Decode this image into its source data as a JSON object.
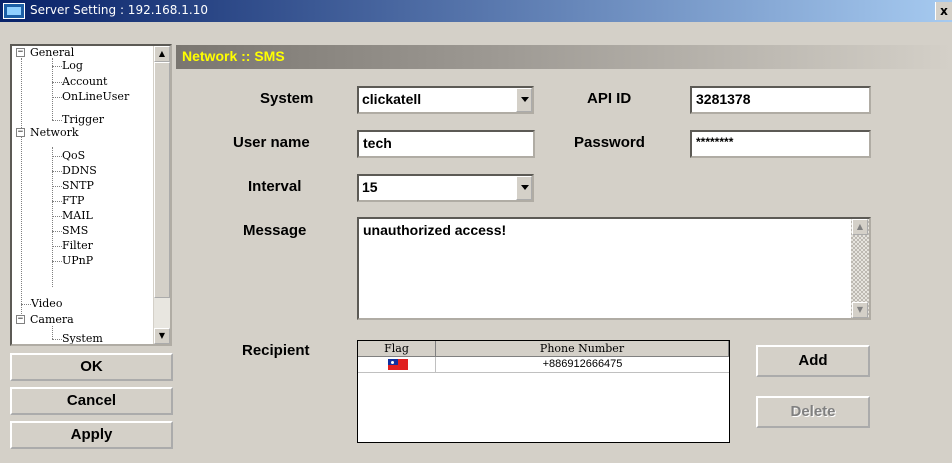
{
  "window": {
    "title": "Server Setting : 192.168.1.10",
    "close_glyph": "x"
  },
  "tree": {
    "items": [
      {
        "label": "General",
        "expander": "−"
      },
      {
        "label": "Log"
      },
      {
        "label": "Account"
      },
      {
        "label": "OnLineUser"
      },
      {
        "label": "Trigger"
      },
      {
        "label": "Network",
        "expander": "−"
      },
      {
        "label": "QoS"
      },
      {
        "label": "DDNS"
      },
      {
        "label": "SNTP"
      },
      {
        "label": "FTP"
      },
      {
        "label": "MAIL"
      },
      {
        "label": "SMS"
      },
      {
        "label": "Filter"
      },
      {
        "label": "UPnP"
      },
      {
        "label": "Video"
      },
      {
        "label": "Camera",
        "expander": "−"
      },
      {
        "label": "System"
      }
    ],
    "scroll_up": "▲",
    "scroll_down": "▼"
  },
  "buttons": {
    "ok": "OK",
    "cancel": "Cancel",
    "apply": "Apply"
  },
  "panel": {
    "header": "Network :: SMS"
  },
  "form": {
    "system_label": "System",
    "system_value": "clickatell",
    "api_id_label": "API ID",
    "api_id_value": "3281378",
    "username_label": "User name",
    "username_value": "tech",
    "password_label": "Password",
    "password_value": "********",
    "interval_label": "Interval",
    "interval_value": "15",
    "message_label": "Message",
    "message_value": "unauthorized access!",
    "recipient_label": "Recipient"
  },
  "recipient_table": {
    "columns": [
      "Flag",
      "Phone Number"
    ],
    "rows": [
      {
        "flag": "taiwan-flag-icon",
        "phone": "+886912666475"
      }
    ]
  },
  "actions": {
    "add": "Add",
    "delete": "Delete"
  },
  "colors": {
    "header_text": "#ffff00",
    "title_bar": "#0a246a",
    "disabled_text": "#808080"
  }
}
